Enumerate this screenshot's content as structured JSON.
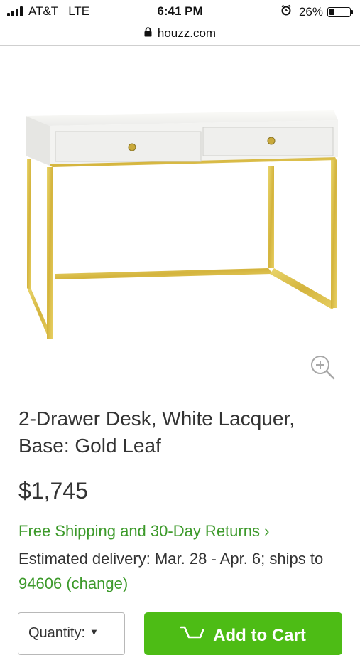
{
  "status_bar": {
    "carrier": "AT&T",
    "network": "LTE",
    "time": "6:41 PM",
    "battery": "26%",
    "battery_level": 0.26
  },
  "browser": {
    "url": "houzz.com"
  },
  "product": {
    "title": "2-Drawer Desk, White Lacquer, Base: Gold Leaf",
    "price": "$1,745",
    "shipping_link": "Free Shipping and 30-Day Returns",
    "shipping_chevron": "›",
    "delivery_text": "Estimated delivery: Mar. 28 - Apr. 6; ships to",
    "zip": "94606",
    "change_link": "(change)"
  },
  "purchase": {
    "quantity_label": "Quantity:",
    "add_to_cart_label": "Add to Cart"
  },
  "colors": {
    "accent_green": "#3d9a2b",
    "cart_button": "#4dbc15"
  },
  "icons": [
    "signal-icon",
    "alarm-icon",
    "battery-icon",
    "lock-icon",
    "zoom-in-icon",
    "cart-icon",
    "caret-down-icon"
  ]
}
